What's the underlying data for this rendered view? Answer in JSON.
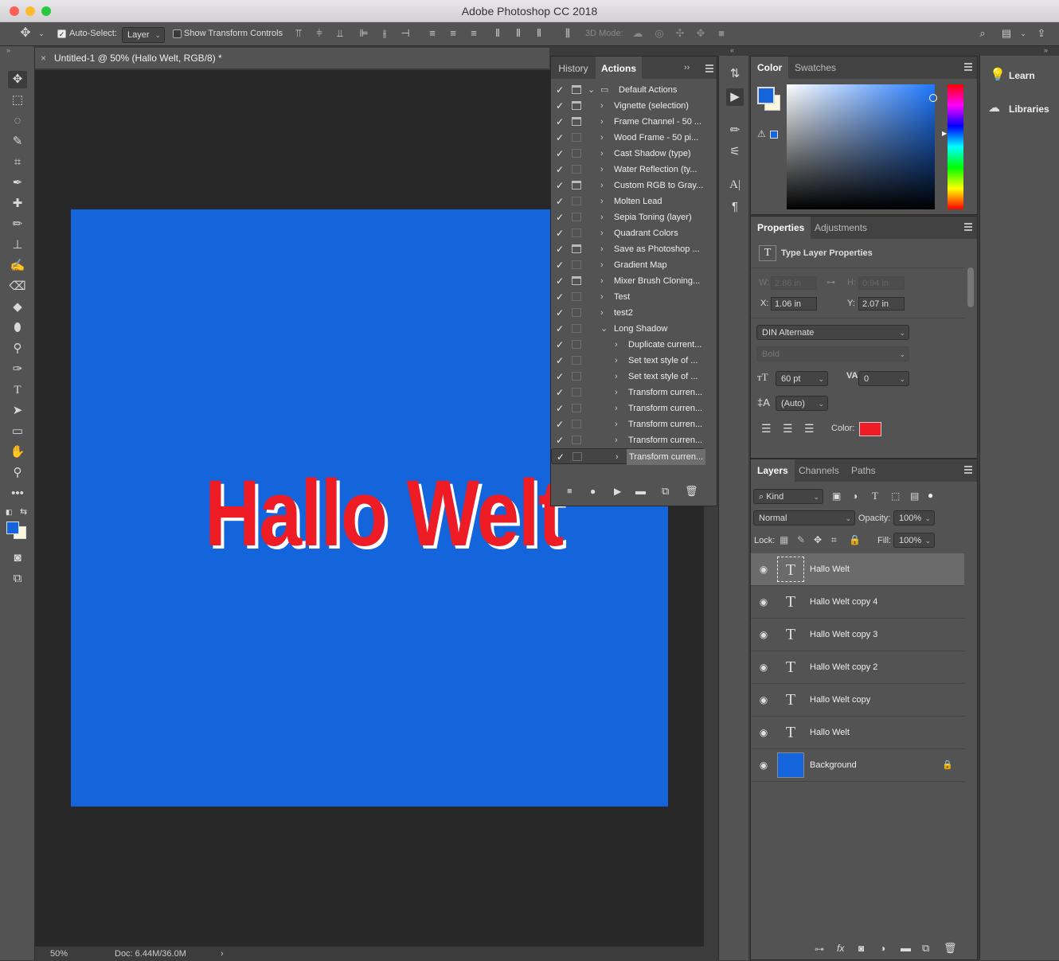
{
  "app": {
    "title": "Adobe Photoshop CC 2018"
  },
  "options": {
    "auto_select_label": "Auto-Select:",
    "auto_select_value": "Layer",
    "show_transform_label": "Show Transform Controls",
    "three_d_mode_label": "3D Mode:"
  },
  "document": {
    "tab_title": "Untitled-1 @ 50% (Hallo Welt, RGB/8) *",
    "canvas_text": "Hallo Welt",
    "canvas_color": "#1464dc",
    "text_color": "#ee1c25",
    "zoom": "50%",
    "doc_size": "Doc: 6.44M/36.0M"
  },
  "actions_panel": {
    "tabs": [
      "History",
      "Actions"
    ],
    "items": [
      {
        "name": "Default Actions",
        "level": 0,
        "open": true,
        "folder": true,
        "dialog": true
      },
      {
        "name": "Vignette (selection)",
        "level": 1,
        "dialog": true
      },
      {
        "name": "Frame Channel - 50 ...",
        "level": 1,
        "dialog": true
      },
      {
        "name": "Wood Frame - 50 pi...",
        "level": 1,
        "dialog": false
      },
      {
        "name": "Cast Shadow (type)",
        "level": 1,
        "dialog": false
      },
      {
        "name": "Water Reflection (ty...",
        "level": 1,
        "dialog": false
      },
      {
        "name": "Custom RGB to Gray...",
        "level": 1,
        "dialog": true
      },
      {
        "name": "Molten Lead",
        "level": 1,
        "dialog": false
      },
      {
        "name": "Sepia Toning (layer)",
        "level": 1,
        "dialog": false
      },
      {
        "name": "Quadrant Colors",
        "level": 1,
        "dialog": false
      },
      {
        "name": "Save as Photoshop ...",
        "level": 1,
        "dialog": true
      },
      {
        "name": "Gradient Map",
        "level": 1,
        "dialog": false
      },
      {
        "name": "Mixer Brush Cloning...",
        "level": 1,
        "dialog": true
      },
      {
        "name": "Test",
        "level": 1,
        "dialog": false
      },
      {
        "name": "test2",
        "level": 1,
        "dialog": false
      },
      {
        "name": "Long Shadow",
        "level": 1,
        "open": true,
        "dialog": false
      },
      {
        "name": "Duplicate current...",
        "level": 2,
        "dialog": false
      },
      {
        "name": "Set text style of ...",
        "level": 2,
        "dialog": false
      },
      {
        "name": "Set text style of ...",
        "level": 2,
        "dialog": false
      },
      {
        "name": "Transform curren...",
        "level": 2,
        "dialog": false
      },
      {
        "name": "Transform curren...",
        "level": 2,
        "dialog": false
      },
      {
        "name": "Transform curren...",
        "level": 2,
        "dialog": false
      },
      {
        "name": "Transform curren...",
        "level": 2,
        "dialog": false
      },
      {
        "name": "Transform curren...",
        "level": 2,
        "dialog": false,
        "selected": true
      }
    ]
  },
  "color_panel": {
    "tabs": [
      "Color",
      "Swatches"
    ],
    "fg": "#1464dc",
    "bg": "#fbf7dc"
  },
  "properties": {
    "tabs": [
      "Properties",
      "Adjustments"
    ],
    "heading": "Type Layer Properties",
    "w_label": "W:",
    "w_value": "2.86 in",
    "h_label": "H:",
    "h_value": "0.94 in",
    "x_label": "X:",
    "x_value": "1.06 in",
    "y_label": "Y:",
    "y_value": "2.07 in",
    "font": "DIN Alternate",
    "style": "Bold",
    "size": "60 pt",
    "tracking": "0",
    "leading": "(Auto)",
    "color_label": "Color:",
    "color": "#ee1c25"
  },
  "layers_panel": {
    "tabs": [
      "Layers",
      "Channels",
      "Paths"
    ],
    "filter": "Kind",
    "blend": "Normal",
    "opacity_label": "Opacity:",
    "opacity": "100%",
    "lock_label": "Lock:",
    "fill_label": "Fill:",
    "fill": "100%",
    "layers": [
      {
        "name": "Hallo Welt",
        "type": "text",
        "selected": true
      },
      {
        "name": "Hallo Welt copy 4",
        "type": "text"
      },
      {
        "name": "Hallo Welt copy 3",
        "type": "text"
      },
      {
        "name": "Hallo Welt copy 2",
        "type": "text"
      },
      {
        "name": "Hallo Welt copy",
        "type": "text"
      },
      {
        "name": "Hallo Welt",
        "type": "text"
      },
      {
        "name": "Background",
        "type": "fill",
        "locked": true
      }
    ]
  },
  "sidebar": {
    "learn": "Learn",
    "libraries": "Libraries"
  }
}
